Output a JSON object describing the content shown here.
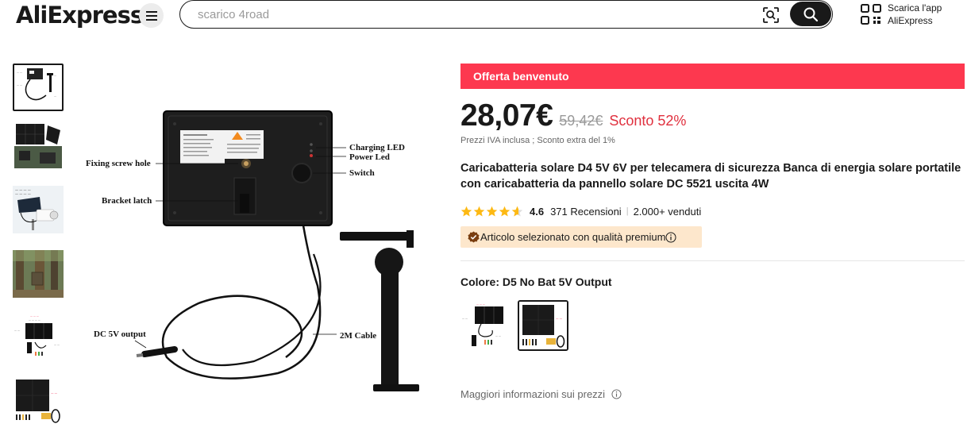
{
  "header": {
    "logo": "AliExpress",
    "search_placeholder": "scarico 4road",
    "app_line1": "Scarica l'app",
    "app_line2": "AliExpress"
  },
  "product": {
    "banner": "Offerta benvenuto",
    "price": "28,07€",
    "old_price": "59,42€",
    "discount": "Sconto 52%",
    "vat_note": "Prezzi IVA inclusa ; Sconto extra del 1%",
    "title": "Caricabatteria solare D4 5V 6V per telecamera di sicurezza Banca di energia solare portatile con caricabatteria da pannello solare DC 5521 uscita 4W",
    "rating": "4.6",
    "rating_stars": 4.6,
    "reviews": "371 Recensioni",
    "sold": "2.000+ venduti",
    "premium": "Articolo selezionato con qualità premium",
    "color_label": "Colore: D5 No Bat 5V Output",
    "more_info": "Maggiori informazioni sui prezzi"
  },
  "image_labels": {
    "charging_led": "Charging LED",
    "power_led": "Power Led",
    "switch": "Switch",
    "fixing_screw": "Fixing screw hole",
    "bracket_latch": "Bracket latch",
    "dc_output": "DC  5V output",
    "cable": "2M Cable"
  },
  "colors": {
    "accent": "#fd384f",
    "discount": "#e0303e",
    "star": "#fdb913",
    "premium_bg": "#fde7cc"
  }
}
